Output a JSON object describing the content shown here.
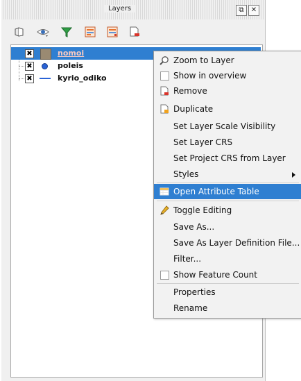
{
  "panel": {
    "title": "Layers",
    "float_glyph": "⧉",
    "close_glyph": "✕"
  },
  "layers": [
    {
      "name": "nomoi",
      "checked": "✖",
      "selected": true,
      "symbol": "fill",
      "color": "#9a8a72"
    },
    {
      "name": "poleis",
      "checked": "✖",
      "selected": false,
      "symbol": "point",
      "color": "#2a63d6"
    },
    {
      "name": "kyrio_odiko",
      "checked": "✖",
      "selected": false,
      "symbol": "line",
      "color": "#2a63d6"
    }
  ],
  "menu": {
    "items": [
      {
        "key": "zoom",
        "label": "Zoom to Layer",
        "icon": "zoom-icon"
      },
      {
        "key": "overview",
        "label": "Show in overview",
        "icon": "checkbox-icon"
      },
      {
        "key": "remove",
        "label": "Remove",
        "icon": "remove-layer-icon"
      },
      {
        "key": "duplicate",
        "label": "Duplicate",
        "icon": "duplicate-layer-icon"
      },
      {
        "key": "scale",
        "label": "Set Layer Scale Visibility"
      },
      {
        "key": "layer_crs",
        "label": "Set Layer CRS"
      },
      {
        "key": "project_crs",
        "label": "Set Project CRS from Layer"
      },
      {
        "key": "styles",
        "label": "Styles",
        "submenu": true
      },
      {
        "key": "attr_table",
        "label": "Open Attribute Table",
        "icon": "table-icon",
        "highlighted": true
      },
      {
        "key": "editing",
        "label": "Toggle Editing",
        "icon": "pencil-icon"
      },
      {
        "key": "save_as",
        "label": "Save As..."
      },
      {
        "key": "save_def",
        "label": "Save As Layer Definition File..."
      },
      {
        "key": "filter",
        "label": "Filter..."
      },
      {
        "key": "count",
        "label": "Show Feature Count",
        "icon": "checkbox-icon"
      },
      {
        "key": "properties",
        "label": "Properties"
      },
      {
        "key": "rename",
        "label": "Rename"
      }
    ]
  },
  "colors": {
    "selection": "#2f7fd1",
    "menu_bg": "#f2f2f2"
  }
}
